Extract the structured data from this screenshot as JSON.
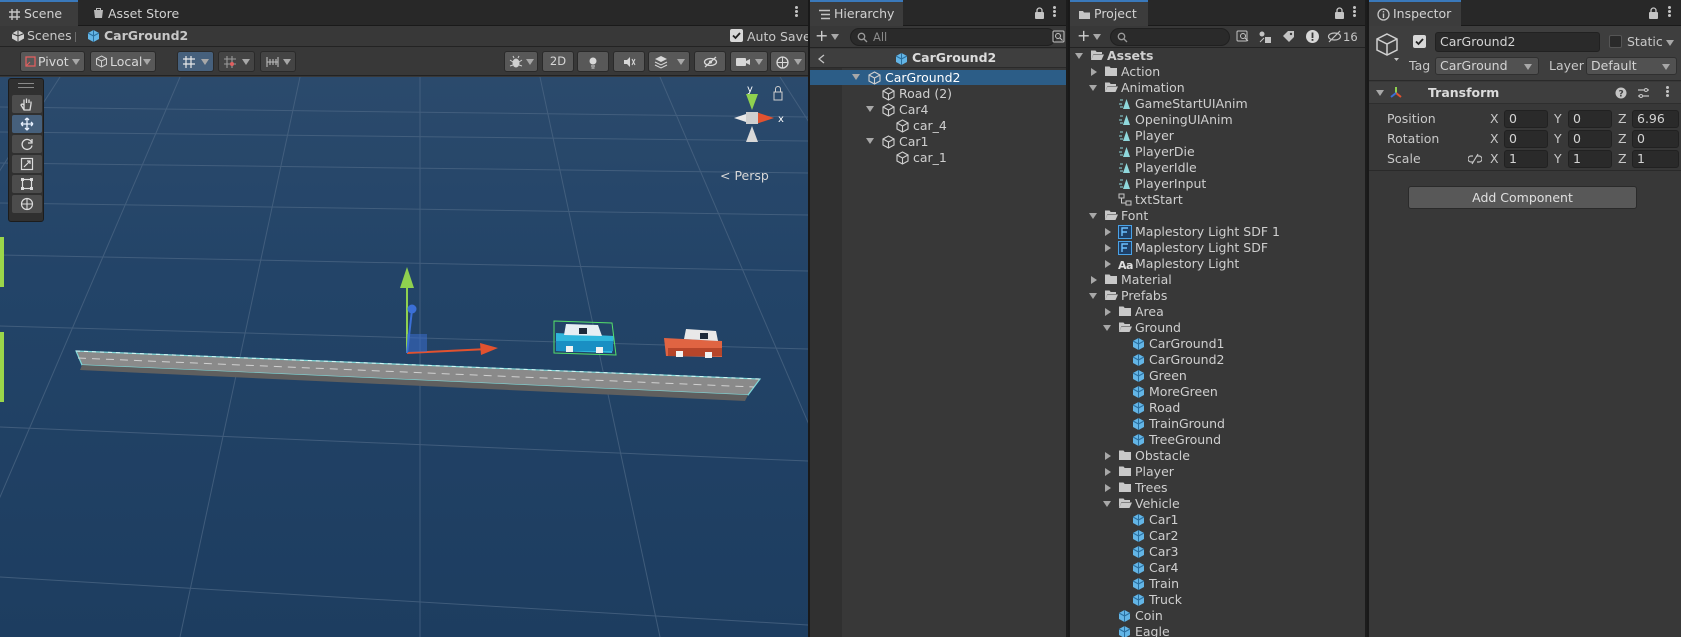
{
  "scene": {
    "tabs": [
      {
        "label": "Scene",
        "icon": "grid-icon",
        "active": true
      },
      {
        "label": "Asset Store",
        "icon": "store-icon",
        "active": false
      }
    ],
    "breadcrumb": {
      "root": "Scenes",
      "current": "CarGround2"
    },
    "auto_save": {
      "label": "Auto Save",
      "checked": true
    },
    "toolbar": {
      "pivot": "Pivot",
      "local": "Local",
      "mode_2d": "2D"
    },
    "gizmo": {
      "y_label": "y",
      "x_label": "x",
      "projection": "< Persp"
    }
  },
  "hierarchy": {
    "tab": "Hierarchy",
    "search_placeholder": "All",
    "prefab_header": "CarGround2",
    "items": [
      {
        "label": "CarGround2",
        "depth": 0,
        "expanded": true,
        "selected": true
      },
      {
        "label": "Road (2)",
        "depth": 1,
        "expanded": null,
        "selected": false
      },
      {
        "label": "Car4",
        "depth": 1,
        "expanded": true,
        "selected": false
      },
      {
        "label": "car_4",
        "depth": 2,
        "expanded": null,
        "selected": false
      },
      {
        "label": "Car1",
        "depth": 1,
        "expanded": true,
        "selected": false
      },
      {
        "label": "car_1",
        "depth": 2,
        "expanded": null,
        "selected": false
      }
    ]
  },
  "project": {
    "tab": "Project",
    "hidden_count": "16",
    "items": [
      {
        "label": "Assets",
        "depth": 0,
        "type": "folder-open",
        "expanded": true
      },
      {
        "label": "Action",
        "depth": 1,
        "type": "folder",
        "expanded": false
      },
      {
        "label": "Animation",
        "depth": 1,
        "type": "folder-open",
        "expanded": true
      },
      {
        "label": "GameStartUIAnim",
        "depth": 2,
        "type": "anim",
        "expanded": null
      },
      {
        "label": "OpeningUIAnim",
        "depth": 2,
        "type": "anim",
        "expanded": null
      },
      {
        "label": "Player",
        "depth": 2,
        "type": "anim",
        "expanded": null
      },
      {
        "label": "PlayerDie",
        "depth": 2,
        "type": "anim",
        "expanded": null
      },
      {
        "label": "PlayerIdle",
        "depth": 2,
        "type": "anim",
        "expanded": null
      },
      {
        "label": "PlayerInput",
        "depth": 2,
        "type": "anim",
        "expanded": null
      },
      {
        "label": "txtStart",
        "depth": 2,
        "type": "controller",
        "expanded": null
      },
      {
        "label": "Font",
        "depth": 1,
        "type": "folder-open",
        "expanded": true
      },
      {
        "label": "Maplestory Light SDF 1",
        "depth": 2,
        "type": "fontasset",
        "expanded": false
      },
      {
        "label": "Maplestory Light SDF",
        "depth": 2,
        "type": "fontasset",
        "expanded": false
      },
      {
        "label": "Maplestory Light",
        "depth": 2,
        "type": "font",
        "expanded": false
      },
      {
        "label": "Material",
        "depth": 1,
        "type": "folder",
        "expanded": false
      },
      {
        "label": "Prefabs",
        "depth": 1,
        "type": "folder-open",
        "expanded": true
      },
      {
        "label": "Area",
        "depth": 2,
        "type": "folder",
        "expanded": false
      },
      {
        "label": "Ground",
        "depth": 2,
        "type": "folder-open",
        "expanded": true
      },
      {
        "label": "CarGround1",
        "depth": 3,
        "type": "prefab",
        "expanded": null
      },
      {
        "label": "CarGround2",
        "depth": 3,
        "type": "prefab",
        "expanded": null
      },
      {
        "label": "Green",
        "depth": 3,
        "type": "prefab",
        "expanded": null
      },
      {
        "label": "MoreGreen",
        "depth": 3,
        "type": "prefab",
        "expanded": null
      },
      {
        "label": "Road",
        "depth": 3,
        "type": "prefab",
        "expanded": null
      },
      {
        "label": "TrainGround",
        "depth": 3,
        "type": "prefab",
        "expanded": null
      },
      {
        "label": "TreeGround",
        "depth": 3,
        "type": "prefab",
        "expanded": null
      },
      {
        "label": "Obstacle",
        "depth": 2,
        "type": "folder",
        "expanded": false
      },
      {
        "label": "Player",
        "depth": 2,
        "type": "folder",
        "expanded": false
      },
      {
        "label": "Trees",
        "depth": 2,
        "type": "folder",
        "expanded": false
      },
      {
        "label": "Vehicle",
        "depth": 2,
        "type": "folder-open",
        "expanded": true
      },
      {
        "label": "Car1",
        "depth": 3,
        "type": "prefab",
        "expanded": null
      },
      {
        "label": "Car2",
        "depth": 3,
        "type": "prefab",
        "expanded": null
      },
      {
        "label": "Car3",
        "depth": 3,
        "type": "prefab",
        "expanded": null
      },
      {
        "label": "Car4",
        "depth": 3,
        "type": "prefab",
        "expanded": null
      },
      {
        "label": "Train",
        "depth": 3,
        "type": "prefab",
        "expanded": null
      },
      {
        "label": "Truck",
        "depth": 3,
        "type": "prefab",
        "expanded": null
      },
      {
        "label": "Coin",
        "depth": 2,
        "type": "prefab",
        "expanded": null
      },
      {
        "label": "Eagle",
        "depth": 2,
        "type": "prefab",
        "expanded": null
      }
    ]
  },
  "inspector": {
    "tab": "Inspector",
    "object_name": "CarGround2",
    "active": true,
    "static_label": "Static",
    "static_checked": false,
    "tag_label": "Tag",
    "tag_value": "CarGround",
    "layer_label": "Layer",
    "layer_value": "Default",
    "transform": {
      "title": "Transform",
      "rows": [
        {
          "label": "Position",
          "x": "0",
          "y": "0",
          "z": "6.96"
        },
        {
          "label": "Rotation",
          "x": "0",
          "y": "0",
          "z": "0"
        },
        {
          "label": "Scale",
          "x": "1",
          "y": "1",
          "z": "1"
        }
      ],
      "axis": {
        "x": "X",
        "y": "Y",
        "z": "Z"
      }
    },
    "add_component": "Add Component"
  },
  "colors": {
    "accent": "#3a79bb",
    "selection": "#2c5d87",
    "viewport": "#1e3a5a",
    "prefab": "#63b5e6"
  }
}
